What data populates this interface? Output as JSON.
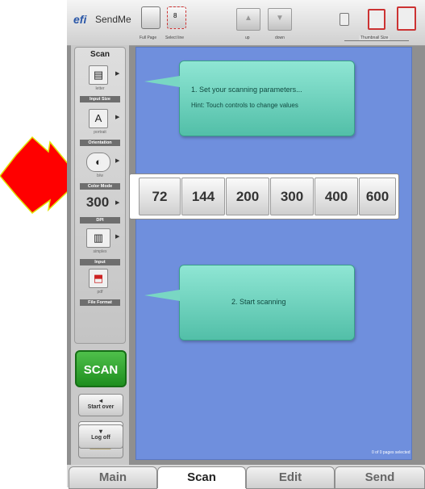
{
  "app": {
    "logo": "efi",
    "title": "SendMe"
  },
  "toolbar": {
    "full_page_label": "Full Page",
    "select_line_label": "Select line",
    "select_line_icon": "8",
    "up_label": "up",
    "down_label": "down",
    "thumbnail_size_label": "Thumbnail Size",
    "page_thumb_icon": "page-icon"
  },
  "sidebar": {
    "title": "Scan",
    "items": [
      {
        "icon": "▤",
        "value": "letter",
        "label": "Input Size"
      },
      {
        "icon": "A",
        "value": "portrait",
        "label": "Orientation"
      },
      {
        "icon": "◐",
        "value": "b/w",
        "label": "Color Mode"
      },
      {
        "icon": "300",
        "value": "",
        "label": "DPI"
      },
      {
        "icon": "▥",
        "value": "simplex",
        "label": "Input"
      },
      {
        "icon": "⬒",
        "value": "pdf",
        "label": "File Format"
      }
    ],
    "scan_button": "SCAN",
    "start_over": "Start over",
    "start_over_icon": "◂",
    "log_off": "Log off",
    "log_off_icon": "▾"
  },
  "main": {
    "hint1_line1": "1. Set your scanning parameters...",
    "hint1_line2": "Hint: Touch controls to change values",
    "hint2": "2. Start scanning",
    "dpi_options": [
      "72",
      "144",
      "200",
      "300",
      "400",
      "600"
    ],
    "status": "0 of 0 pages selected"
  },
  "tabs": [
    "Main",
    "Scan",
    "Edit",
    "Send"
  ],
  "colors": {
    "accent": "#6f8fdd",
    "bubble": "#67cdb6",
    "scan_button": "#2a9f2a",
    "arrow": "#ff0000"
  }
}
